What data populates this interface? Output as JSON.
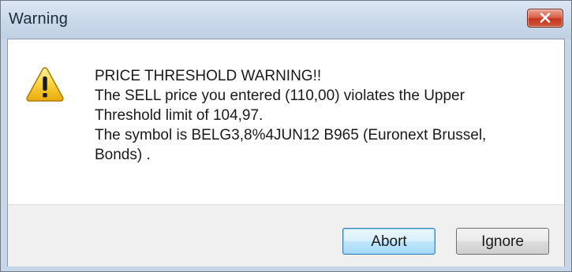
{
  "window": {
    "title": "Warning"
  },
  "icons": {
    "dialog_icon": "warning-icon",
    "close": "close-icon",
    "accent_close": "#c3351c"
  },
  "message": {
    "line1": "PRICE THRESHOLD WARNING!!",
    "line2": "The SELL price you entered (110,00) violates the Upper",
    "line3": "Threshold limit of 104,97.",
    "line4": "The symbol is BELG3,8%4JUN12 B965 (Euronext Brussel,",
    "line5": "Bonds) ."
  },
  "buttons": {
    "abort_label": "Abort",
    "ignore_label": "Ignore",
    "default": "Abort"
  }
}
